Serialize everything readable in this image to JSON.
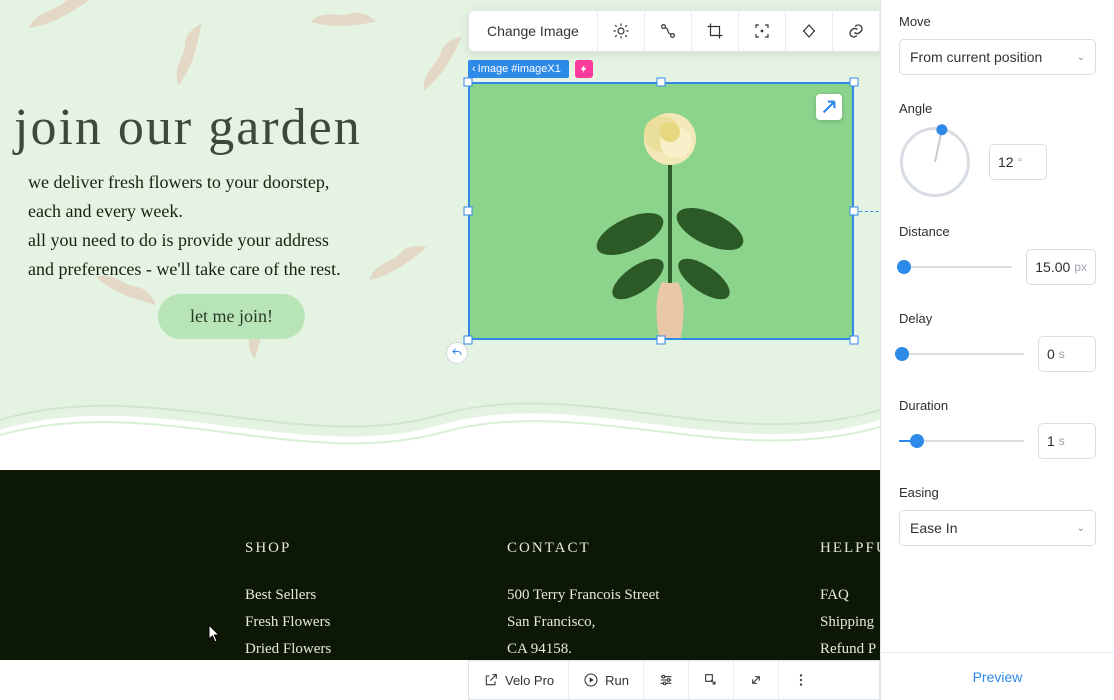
{
  "toolbar": {
    "change_image": "Change Image"
  },
  "selection": {
    "label": "Image #imageX1"
  },
  "hero": {
    "title": "join our garden",
    "line1": "we deliver fresh flowers to your doorstep,",
    "line2": "each and every week.",
    "line3": "all you need to do is provide your address",
    "line4": "and preferences - we'll take care of the rest.",
    "cta": "let me join!"
  },
  "footer": {
    "shop": {
      "heading": "SHOP",
      "items": [
        "Best Sellers",
        "Fresh Flowers",
        "Dried Flowers"
      ]
    },
    "contact": {
      "heading": "CONTACT",
      "addr1": "500 Terry Francois Street",
      "addr2": "San Francisco,",
      "addr3": "CA 94158."
    },
    "help": {
      "heading": "HELPFU",
      "items": [
        "FAQ",
        "Shipping",
        "Refund P"
      ]
    }
  },
  "panel": {
    "move_label": "Move",
    "move_value": "From current position",
    "angle_label": "Angle",
    "angle_value": "12",
    "angle_unit": "°",
    "distance_label": "Distance",
    "distance_value": "15.00",
    "distance_unit": "px",
    "delay_label": "Delay",
    "delay_value": "0",
    "delay_unit": "s",
    "duration_label": "Duration",
    "duration_value": "1",
    "duration_unit": "s",
    "easing_label": "Easing",
    "easing_value": "Ease In",
    "preview": "Preview"
  },
  "devbar": {
    "velo": "Velo Pro",
    "run": "Run"
  },
  "sliders": {
    "distance_pct": 4,
    "delay_pct": 2,
    "duration_pct": 14
  }
}
